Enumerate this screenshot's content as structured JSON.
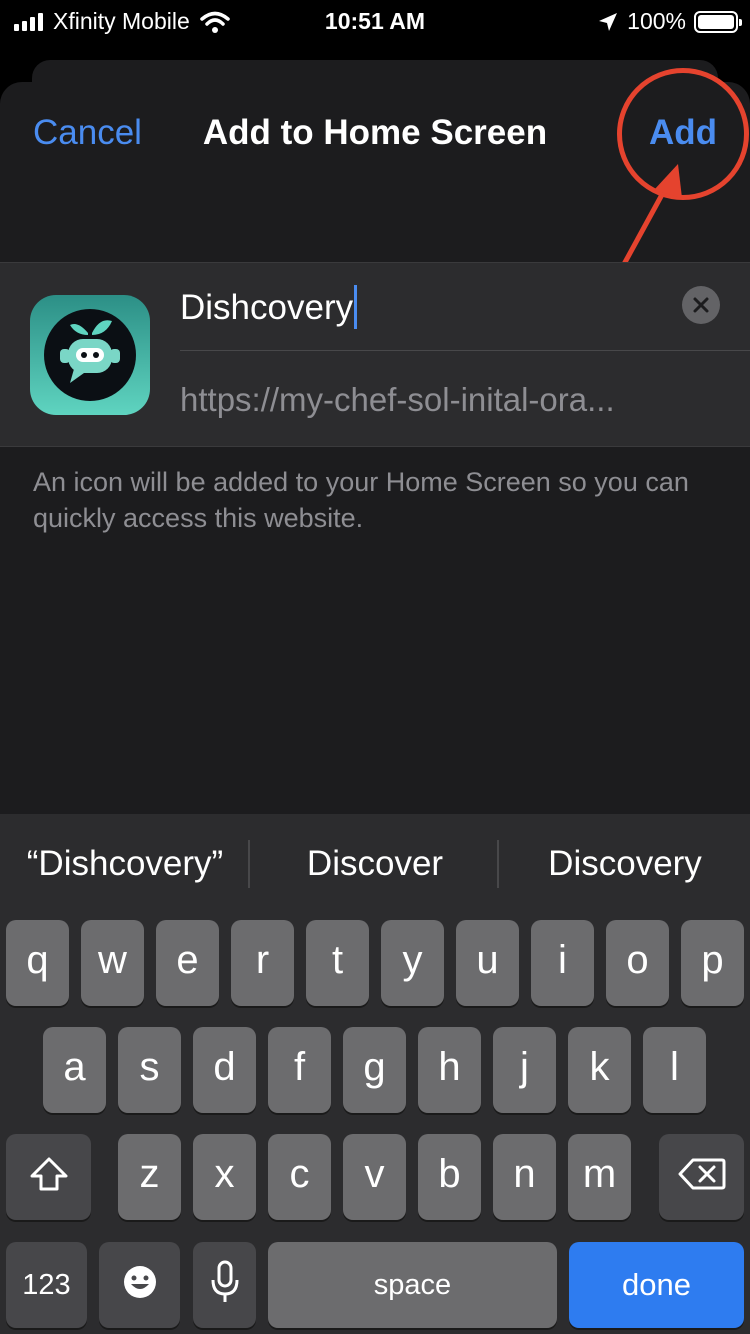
{
  "status_bar": {
    "carrier": "Xfinity Mobile",
    "time": "10:51 AM",
    "battery": "100%",
    "battery_level": 1.0
  },
  "sheet": {
    "cancel_label": "Cancel",
    "title": "Add to Home Screen",
    "add_label": "Add",
    "name_value": "Dishcovery",
    "url_value": "https://my-chef-sol-inital-ora...",
    "hint_text": "An icon will be added to your Home Screen so you can quickly access this website."
  },
  "keyboard": {
    "suggestions": [
      "“Dishcovery”",
      "Discover",
      "Discovery"
    ],
    "row1": [
      "q",
      "w",
      "e",
      "r",
      "t",
      "y",
      "u",
      "i",
      "o",
      "p"
    ],
    "row2": [
      "a",
      "s",
      "d",
      "f",
      "g",
      "h",
      "j",
      "k",
      "l"
    ],
    "row3": [
      "z",
      "x",
      "c",
      "v",
      "b",
      "n",
      "m"
    ],
    "numbers_label": "123",
    "space_label": "space",
    "done_label": "done"
  },
  "colors": {
    "accent": "#4a8cf0",
    "annotation": "#e5432e",
    "done_key": "#2e7cf0"
  }
}
